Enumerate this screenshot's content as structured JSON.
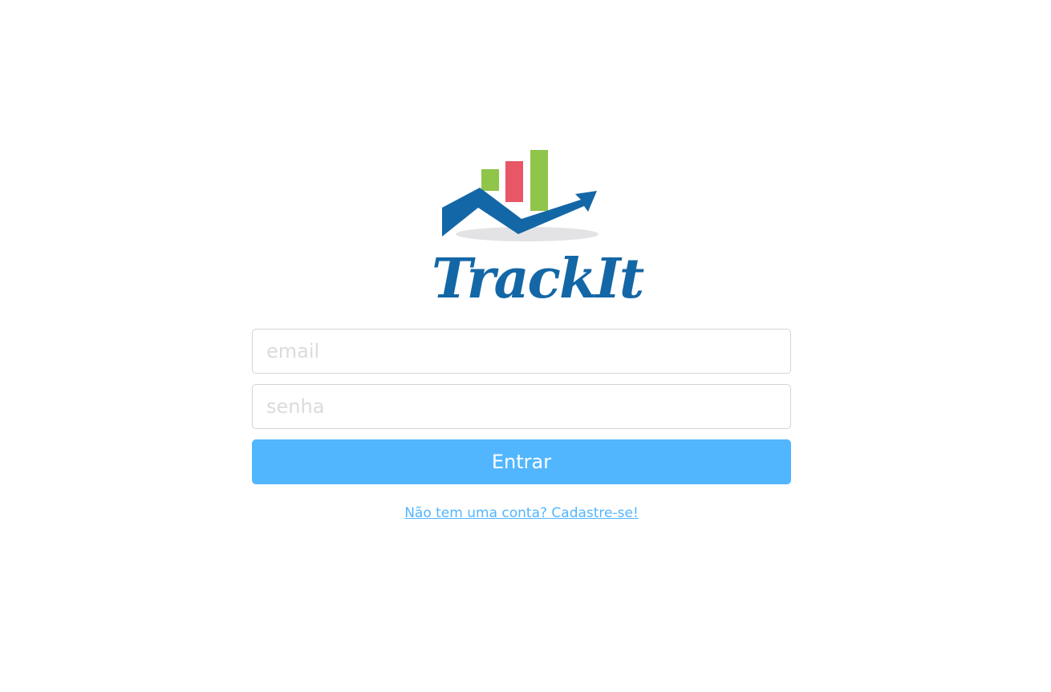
{
  "app": {
    "name": "TrackIt"
  },
  "login": {
    "email_placeholder": "email",
    "email_value": "",
    "password_placeholder": "senha",
    "password_value": "",
    "submit_label": "Entrar",
    "signup_link": "Não tem uma conta? Cadastre-se!"
  },
  "colors": {
    "brand_blue": "#1467a6",
    "accent_blue": "#52b6ff",
    "bar_green": "#8fc549",
    "bar_red": "#e75766",
    "input_border": "#d4d4d4",
    "placeholder": "#dbdbdb"
  },
  "icons": {
    "logo": "growth-chart-logo-icon"
  }
}
